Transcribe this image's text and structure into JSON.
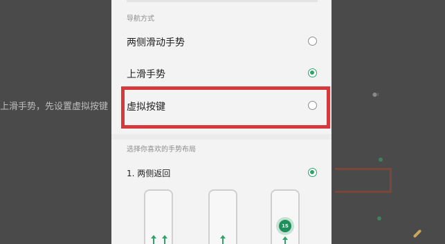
{
  "background": {
    "partial_text": "上滑手势，先设置虚拟按键"
  },
  "nav_settings": {
    "section_title": "导航方式",
    "options": [
      {
        "label": "两侧滑动手势",
        "selected": false
      },
      {
        "label": "上滑手势",
        "selected": true
      },
      {
        "label": "虚拟按键",
        "selected": false
      }
    ]
  },
  "layout_settings": {
    "section_title": "选择你喜欢的手势布局",
    "options": [
      {
        "label": "1. 两侧返回",
        "selected": true
      }
    ],
    "preview_badge": "1S"
  },
  "colors": {
    "accent_green": "#2ea36a",
    "highlight_red": "#d5393b"
  }
}
